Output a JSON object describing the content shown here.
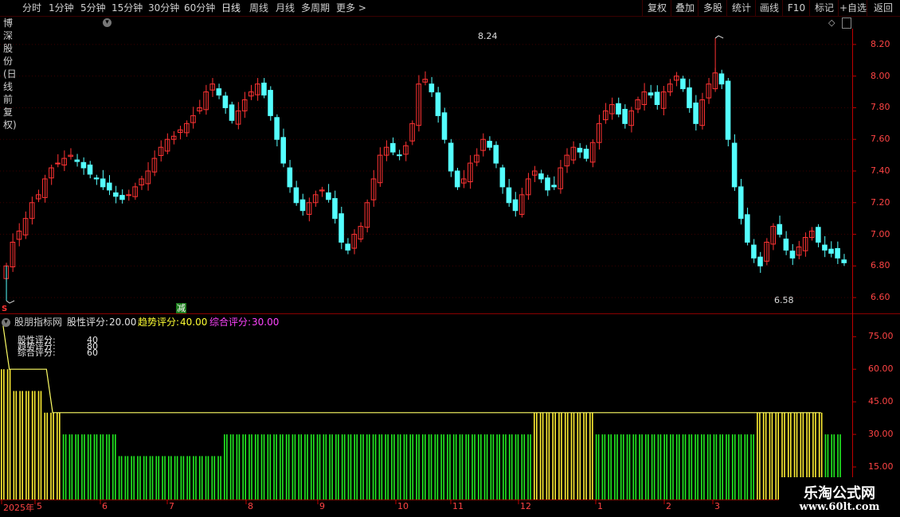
{
  "toolbar": {
    "periods": [
      "分时",
      "1分钟",
      "5分钟",
      "15分钟",
      "30分钟",
      "60分钟",
      "日线",
      "周线",
      "月线",
      "多周期",
      "更多 >"
    ],
    "active_period": "日线",
    "actions": [
      "复权",
      "叠加",
      "多股",
      "统计",
      "画线",
      "F10",
      "标记",
      "+自选",
      "返回"
    ]
  },
  "stock": {
    "title": "博深股份(日线 前复权)",
    "high_marker": "8.24",
    "low_marker": "6.58",
    "event_marker": "减",
    "left_marker": "S"
  },
  "price_axis": {
    "labels": [
      "8.20",
      "8.00",
      "7.80",
      "7.60",
      "7.40",
      "7.20",
      "7.00",
      "6.80",
      "6.60"
    ]
  },
  "indicator": {
    "name": "股朋指标网",
    "stock_score_label": "股性评分:",
    "stock_score": "20.00",
    "trend_score_label": "趋势评分:",
    "trend_score": "40.00",
    "composite_score_label": "综合评分:",
    "composite_score": "30.00",
    "legend_names": [
      "股性评分:",
      "趋势评分:",
      "综合评分:"
    ],
    "legend_values": [
      "40",
      "80",
      "60"
    ],
    "axis_labels": [
      "75.00",
      "60.00",
      "45.00",
      "30.00",
      "15.00"
    ]
  },
  "time_axis": {
    "labels": [
      "2025年",
      "5",
      "6",
      "7",
      "8",
      "9",
      "10",
      "11",
      "12",
      "1",
      "2",
      "3"
    ]
  },
  "watermark": {
    "line1": "乐淘公式网",
    "line2": "www.60lt.com"
  },
  "colors": {
    "up": "#ff3333",
    "down": "#54ffff",
    "trend_line": "#ffff66",
    "bar_green": "#22ee22",
    "bar_yellow": "#ffee33",
    "axis": "#c00000"
  },
  "chart_data": {
    "type": "candlestick",
    "ylim": [
      6.5,
      8.3
    ],
    "price_high": 8.24,
    "price_low": 6.58,
    "close_series": [
      6.8,
      6.95,
      7.02,
      7.1,
      7.2,
      7.25,
      7.35,
      7.42,
      7.45,
      7.48,
      7.5,
      7.46,
      7.42,
      7.38,
      7.35,
      7.3,
      7.28,
      7.24,
      7.22,
      7.25,
      7.3,
      7.35,
      7.4,
      7.48,
      7.55,
      7.6,
      7.62,
      7.66,
      7.7,
      7.75,
      7.8,
      7.9,
      7.95,
      7.88,
      7.8,
      7.72,
      7.78,
      7.85,
      7.9,
      7.95,
      7.88,
      7.75,
      7.6,
      7.45,
      7.3,
      7.2,
      7.15,
      7.2,
      7.25,
      7.28,
      7.22,
      7.1,
      6.95,
      6.9,
      7.0,
      7.05,
      7.2,
      7.35,
      7.5,
      7.55,
      7.52,
      7.5,
      7.56,
      7.7,
      7.95,
      7.98,
      7.9,
      7.75,
      7.6,
      7.4,
      7.3,
      7.35,
      7.45,
      7.5,
      7.6,
      7.55,
      7.45,
      7.3,
      7.2,
      7.15,
      7.25,
      7.35,
      7.4,
      7.35,
      7.28,
      7.3,
      7.42,
      7.5,
      7.55,
      7.52,
      7.48,
      7.58,
      7.7,
      7.78,
      7.82,
      7.76,
      7.7,
      7.78,
      7.85,
      7.9,
      7.88,
      7.82,
      7.9,
      7.95,
      8.0,
      7.92,
      7.8,
      7.7,
      7.85,
      7.95,
      8.02,
      7.95,
      7.6,
      7.3,
      7.1,
      6.95,
      6.85,
      6.8,
      6.95,
      7.05,
      7.0,
      6.9,
      6.85,
      6.92,
      6.98,
      7.02,
      6.95,
      6.9,
      6.88,
      6.85,
      6.82
    ],
    "indicator_series": [
      {
        "name": "趋势评分",
        "type": "line",
        "values": [
          80,
          60,
          60,
          60,
          60,
          60,
          60,
          60,
          40,
          40,
          40,
          40,
          40,
          40,
          40,
          40,
          40,
          40,
          40,
          40,
          40,
          40,
          40,
          40,
          40,
          40,
          40,
          40,
          40,
          40,
          40,
          40,
          40,
          40,
          40,
          40,
          40,
          40,
          40,
          40,
          40,
          40,
          40,
          40,
          40,
          40,
          40,
          40,
          40,
          40,
          40,
          40,
          40,
          40,
          40,
          40,
          40,
          40,
          40,
          40,
          40,
          40,
          40,
          40,
          40,
          40,
          40,
          40,
          40,
          40,
          40,
          40,
          40,
          40,
          40,
          40,
          40,
          40,
          40,
          40,
          40,
          40,
          40,
          40,
          40,
          40,
          40,
          40,
          40,
          40,
          40,
          40,
          40,
          40,
          40,
          40,
          40,
          40,
          40,
          40,
          40,
          40,
          40,
          40,
          40,
          40,
          40,
          40,
          40,
          40,
          40,
          40,
          40,
          40,
          40,
          40,
          40,
          40,
          40,
          40,
          40,
          40,
          40,
          40,
          40,
          40,
          40,
          40,
          40,
          40,
          40,
          40,
          40
        ]
      },
      {
        "name": "综合评分",
        "type": "bar",
        "values": [
          60,
          60,
          50,
          50,
          50,
          50,
          50,
          40,
          40,
          40,
          30,
          30,
          30,
          30,
          30,
          30,
          30,
          30,
          30,
          20,
          20,
          20,
          20,
          20,
          20,
          20,
          20,
          20,
          20,
          20,
          20,
          20,
          20,
          20,
          20,
          20,
          30,
          30,
          30,
          30,
          30,
          30,
          30,
          30,
          30,
          30,
          30,
          30,
          30,
          30,
          30,
          30,
          30,
          30,
          30,
          30,
          30,
          30,
          30,
          30,
          30,
          30,
          30,
          30,
          30,
          30,
          30,
          30,
          30,
          30,
          30,
          30,
          30,
          30,
          30,
          30,
          30,
          30,
          30,
          30,
          30,
          30,
          30,
          30,
          30,
          30,
          40,
          40,
          40,
          40,
          40,
          40,
          40,
          40,
          40,
          40,
          30,
          30,
          30,
          30,
          30,
          30,
          30,
          30,
          30,
          30,
          30,
          30,
          30,
          30,
          30,
          30,
          30,
          30,
          30,
          30,
          30,
          30,
          30,
          30,
          30,
          30,
          40,
          40,
          40,
          40,
          40,
          40,
          40,
          40,
          40,
          40,
          40,
          30,
          30,
          30
        ]
      }
    ]
  }
}
